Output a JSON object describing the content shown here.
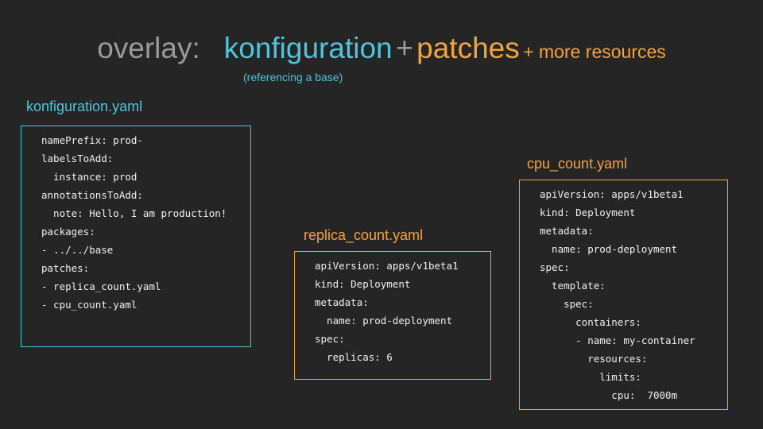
{
  "title": {
    "overlay_label": "overlay:",
    "konfiguration": "konfiguration",
    "plus": "+",
    "patches": "patches",
    "more_resources": "+ more resources",
    "subtitle": "(referencing a base)"
  },
  "colors": {
    "background": "#252525",
    "gray": "#9a9a9a",
    "cyan": "#4fc4dc",
    "orange": "#f2a340",
    "code_text": "#f0f0f0"
  },
  "files": {
    "konfiguration": {
      "name": "konfiguration.yaml",
      "lines": [
        "namePrefix: prod-",
        "labelsToAdd:",
        "  instance: prod",
        "annotationsToAdd:",
        "  note: Hello, I am production!",
        "packages:",
        "- ../../base",
        "patches:",
        "- replica_count.yaml",
        "- cpu_count.yaml"
      ]
    },
    "replica_count": {
      "name": "replica_count.yaml",
      "lines": [
        "apiVersion: apps/v1beta1",
        "kind: Deployment",
        "metadata:",
        "  name: prod-deployment",
        "spec:",
        "  replicas: 6"
      ]
    },
    "cpu_count": {
      "name": "cpu_count.yaml",
      "lines": [
        "apiVersion: apps/v1beta1",
        "kind: Deployment",
        "metadata:",
        "  name: prod-deployment",
        "spec:",
        "  template:",
        "    spec:",
        "      containers:",
        "      - name: my-container",
        "        resources:",
        "          limits:",
        "            cpu:  7000m"
      ]
    }
  }
}
